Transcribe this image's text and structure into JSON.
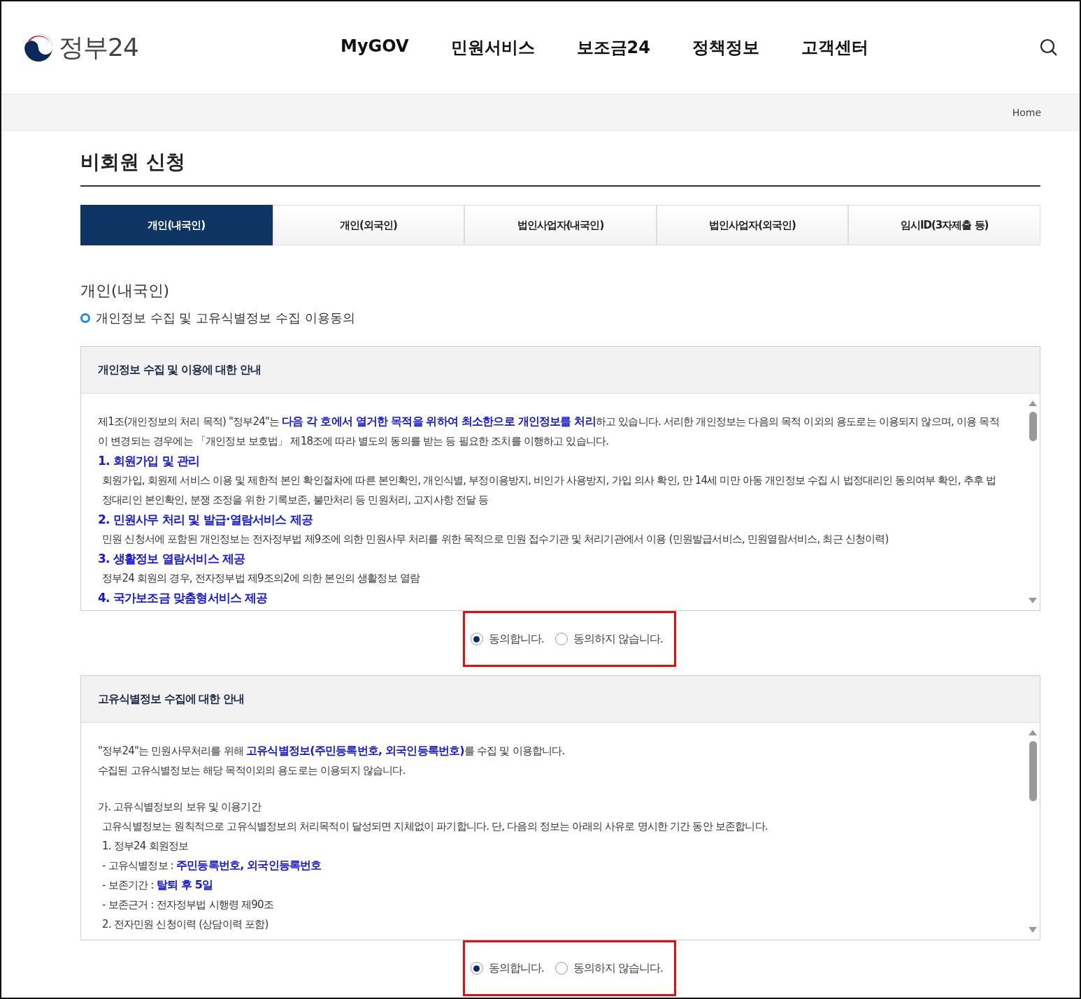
{
  "header": {
    "logo_text": "정부24",
    "nav": [
      "MyGOV",
      "민원서비스",
      "보조금24",
      "정책정보",
      "고객센터"
    ]
  },
  "breadcrumb": "Home",
  "page_title": "비회원 신청",
  "tabs": [
    {
      "label": "개인(내국인)",
      "selected": true
    },
    {
      "label": "개인(외국인)",
      "selected": false
    },
    {
      "label": "법인사업자(내국인)",
      "selected": false
    },
    {
      "label": "법인사업자(외국인)",
      "selected": false
    },
    {
      "label": "임시ID(3자제출 등)",
      "selected": false
    }
  ],
  "section_title": "개인(내국인)",
  "section_subtitle": "개인정보 수집 및 고유식별정보 수집 이용동의",
  "agreements": [
    {
      "title": "개인정보 수집 및 이용에 대한 안내",
      "lines": [
        {
          "kind": "text",
          "text": "제1조(개인정보의 처리 목적) \"정부24\"는 **다음 각 호에서 열거한 목적을 위하여 최소한으로 개인정보를 처리**하고 있습니다. 서리한 개인정보는 다음의 목적 이외의 용도로는 이용되지 않으며, 이용 목적이 변경되는 경우에는 「개인정보 보호법」 제18조에 따라 별도의 동의를 받는 등 필요한 조치를 이행하고 있습니다."
        },
        {
          "kind": "heading",
          "text": "1. 회원가입 및 관리"
        },
        {
          "kind": "indent",
          "text": "회원가입, 회원제 서비스 이용 및 제한적 본인 확인절차에 따른 본인확인, 개인식별, 부정이용방지, 비인가 사용방지, 가입 의사 확인, 만 14세 미만 아동 개인정보 수집 시 법정대리인 동의여부 확인, 추후 법정대리인 본인확인, 분쟁 조정을 위한 기록보존, 불만처리 등 민원처리, 고지사항 전달 등"
        },
        {
          "kind": "heading",
          "text": "2. 민원사무 처리 및 발급·열람서비스 제공"
        },
        {
          "kind": "indent",
          "text": "민원 신청서에 포함된 개인정보는 전자정부법 제9조에 의한 민원사무 처리를 위한 목적으로 민원 접수기관 및 처리기관에서 이용 (민원발급서비스, 민원열람서비스, 최근 신청이력)"
        },
        {
          "kind": "heading",
          "text": "3. 생활정보 열람서비스 제공"
        },
        {
          "kind": "indent",
          "text": "정부24 회원의 경우, 전자정부법 제9조의2에 의한 본인의 생활정보 열람"
        },
        {
          "kind": "heading",
          "text": "4. 국가보조금 맞춤형서비스 제공"
        }
      ],
      "options": [
        {
          "label": "동의합니다.",
          "selected": true
        },
        {
          "label": "동의하지 않습니다.",
          "selected": false
        }
      ],
      "highlighted": true
    },
    {
      "title": "고유식별정보 수집에 대한 안내",
      "lines": [
        {
          "kind": "text",
          "text": "\"정부24\"는 민원사무처리를 위해 **고유식별정보(주민등록번호, 외국인등록번호)**를 수집 및 이용합니다."
        },
        {
          "kind": "text",
          "text": "수집된 고유식별정보는 해당 목적이외의 용도로는 이용되지 않습니다."
        },
        {
          "kind": "gap_text",
          "text": "가. 고유식별정보의 보유 및 이용기간"
        },
        {
          "kind": "indent",
          "text": "고유식별정보는 원칙적으로 고유식별정보의 처리목적이 달성되면 지체없이 파기합니다. 단, 다음의 정보는 아래의 사유로 명시한 기간 동안 보존합니다."
        },
        {
          "kind": "indent",
          "text": "1. 정부24 회원정보"
        },
        {
          "kind": "indent",
          "text": " - 고유식별정보 : **주민등록번호, 외국인등록번호**"
        },
        {
          "kind": "indent",
          "text": " - 보존기간 : **탈퇴 후 5일**"
        },
        {
          "kind": "indent",
          "text": " - 보존근거 : 전자정부법 시행령 제90조"
        },
        {
          "kind": "indent",
          "text": "2. 전자민원 신청이력 (상담이력 포함)"
        }
      ],
      "options": [
        {
          "label": "동의합니다.",
          "selected": true
        },
        {
          "label": "동의하지 않습니다.",
          "selected": false
        }
      ],
      "highlighted": true
    }
  ]
}
